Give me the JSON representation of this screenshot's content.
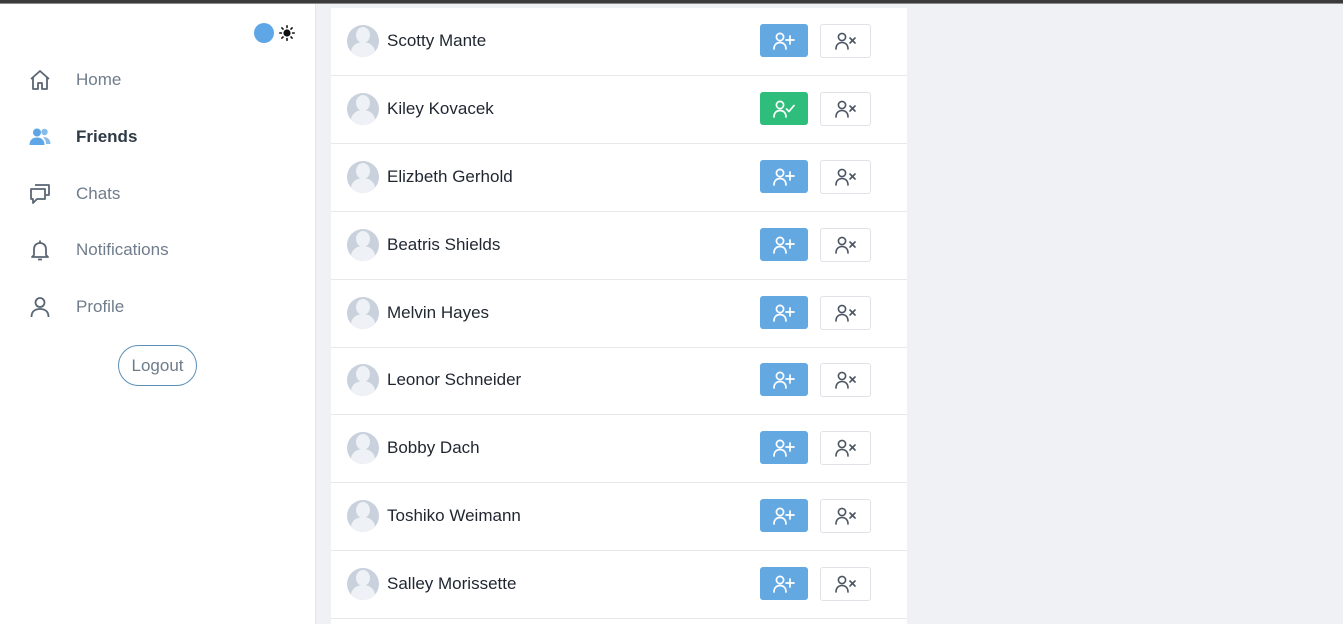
{
  "sidebar": {
    "nav": [
      {
        "label": "Home",
        "icon": "home-icon"
      },
      {
        "label": "Friends",
        "icon": "users-icon",
        "active": true
      },
      {
        "label": "Chats",
        "icon": "chat-icon"
      },
      {
        "label": "Notifications",
        "icon": "bell-icon"
      },
      {
        "label": "Profile",
        "icon": "user-icon"
      }
    ],
    "logout_label": "Logout"
  },
  "theme": {
    "toggle_color": "#5ea6e6",
    "icon": "sun-icon"
  },
  "friends": [
    {
      "name": "Scotty Mante",
      "status": "pending"
    },
    {
      "name": "Kiley Kovacek",
      "status": "accepted"
    },
    {
      "name": "Elizbeth Gerhold",
      "status": "pending"
    },
    {
      "name": "Beatris Shields",
      "status": "pending"
    },
    {
      "name": "Melvin Hayes",
      "status": "pending"
    },
    {
      "name": "Leonor Schneider",
      "status": "pending"
    },
    {
      "name": "Bobby Dach",
      "status": "pending"
    },
    {
      "name": "Toshiko Weimann",
      "status": "pending"
    },
    {
      "name": "Salley Morissette",
      "status": "pending"
    }
  ],
  "colors": {
    "accent": "#64a8e2",
    "accepted": "#2ebd7a",
    "background": "#f0f1f5"
  }
}
